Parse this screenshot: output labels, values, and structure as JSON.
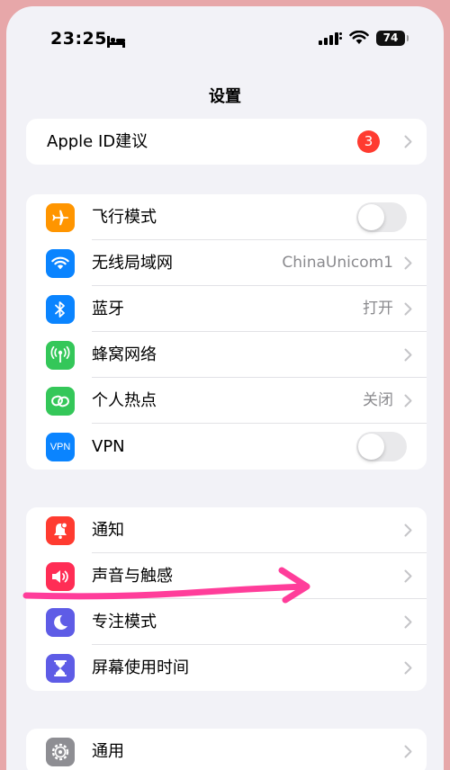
{
  "status_bar": {
    "time": "23:25",
    "battery": "74"
  },
  "nav": {
    "title": "设置"
  },
  "apple_id": {
    "label": "Apple ID建议",
    "badge": "3"
  },
  "group1": [
    {
      "label": "飞行模式",
      "icon": "airplane-icon",
      "color": "#ff9500",
      "control": "toggle-off"
    },
    {
      "label": "无线局域网",
      "icon": "wifi-icon",
      "color": "#0a84ff",
      "value": "ChinaUnicom1"
    },
    {
      "label": "蓝牙",
      "icon": "bluetooth-icon",
      "color": "#0a84ff",
      "value": "打开"
    },
    {
      "label": "蜂窝网络",
      "icon": "cellular-icon",
      "color": "#34c759"
    },
    {
      "label": "个人热点",
      "icon": "hotspot-icon",
      "color": "#34c759",
      "value": "关闭"
    },
    {
      "label": "VPN",
      "icon": "vpn-icon",
      "color": "#0a84ff",
      "icon_text": "VPN",
      "control": "toggle-off"
    }
  ],
  "group2": [
    {
      "label": "通知",
      "icon": "bell-icon",
      "color": "#ff3b30"
    },
    {
      "label": "声音与触感",
      "icon": "speaker-icon",
      "color": "#ff2d55"
    },
    {
      "label": "专注模式",
      "icon": "moon-icon",
      "color": "#5e5ce6"
    },
    {
      "label": "屏幕使用时间",
      "icon": "hourglass-icon",
      "color": "#5e5ce6"
    }
  ],
  "group3": [
    {
      "label": "通用",
      "icon": "gear-icon",
      "color": "#8e8e93"
    }
  ],
  "annotation": {
    "icon": "pink-arrow-annotation",
    "color": "#ff3d9a"
  }
}
